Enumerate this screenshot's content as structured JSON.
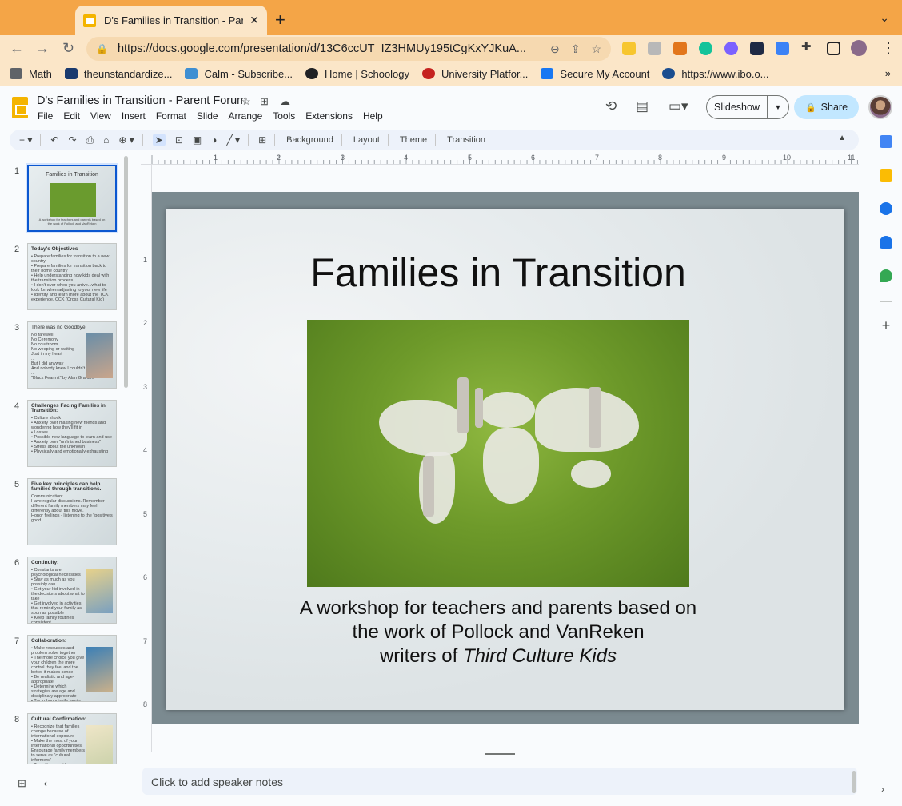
{
  "browser": {
    "tab_title": "D's Families in Transition - Pare",
    "url": "https://docs.google.com/presentation/d/13C6ccUT_IZ3HMUy195tCgKxYJKuA...",
    "bookmarks": [
      "Math",
      "theunstandardize...",
      "Calm - Subscribe...",
      "Home | Schoology",
      "University Platfor...",
      "Secure My Account",
      "https://www.ibo.o..."
    ]
  },
  "doc": {
    "title": "D's Families in Transition - Parent Forum",
    "menus": [
      "File",
      "Edit",
      "View",
      "Insert",
      "Format",
      "Slide",
      "Arrange",
      "Tools",
      "Extensions",
      "Help"
    ],
    "slideshow_label": "Slideshow",
    "share_label": "Share"
  },
  "toolbar": {
    "background": "Background",
    "layout": "Layout",
    "theme": "Theme",
    "transition": "Transition"
  },
  "ruler": {
    "h": [
      "1",
      "2",
      "3",
      "4",
      "5",
      "6",
      "7",
      "8",
      "9",
      "10",
      "11"
    ],
    "v": [
      "1",
      "2",
      "3",
      "4",
      "5",
      "6",
      "7",
      "8"
    ]
  },
  "filmstrip": [
    {
      "num": "1",
      "title": "Families in Transition",
      "lines": "A workshop for teachers and parents based on\nthe work of Pollock and VanReken"
    },
    {
      "num": "2",
      "title": "Today's Objectives",
      "lines": "• Prepare families for transition to a new country\n• Prepare families for transition back to their home country\n• Help understanding how kids deal with the transition process\n• I don't over when you arrive...what to look for when adjusting to your new life\n• Identify and learn more about the TCK experience. CCK (Cross Cultural Kid)"
    },
    {
      "num": "3",
      "title": "There was no Goodbye",
      "lines": "No farewell\nNo Ceremony\nNo courtroom\nNo weeping or waiting\nJust in my heart\n...\nBut I did anyway\nAnd nobody knew I couldn't\n...\n\"Black Fearmit\" by Alan Graham"
    },
    {
      "num": "4",
      "title": "Challenges Facing Families in Transition:",
      "lines": "• Culture shock\n• Anxiety over making new friends and wondering how they'll fit in\n• Losses\n• Possible new language to learn and use\n• Anxiety over \"unfinished business\"\n• Stress about the unknown\n• Physically and emotionally exhausting"
    },
    {
      "num": "5",
      "title": "Five key principles can help families through transitions.",
      "lines": "Communication:\nHave regular discussions. Remember different family members may feel differently about this move.\nHonor feelings - listening to the \"positive's good..."
    },
    {
      "num": "6",
      "title": "Continuity:",
      "lines": "• Constants are psychological necessities\n• Stay as much as you possibly can\n• Get your kid involved in the decisions about what to take\n• Get involved in activities that remind your family as soon as possible\n• Keep family routines consistent\n• Maintain family traditions\n• Create \"welcome rituals\""
    },
    {
      "num": "7",
      "title": "Collaboration:",
      "lines": "• Make resources and problem solve together\n• The more choice you give your children the more control they feel and the better it makes sense\n• Be realistic and age-appropriate\n• Determine which strategies are age and disciplinary appropriate\n• Try to honor/unify family feelings"
    },
    {
      "num": "8",
      "title": "Cultural Confirmation:",
      "lines": "• Recognize that families change because of international exposure\n• Make the most of your international opportunities. Encourage family members to serve as \"cultural informers\"\n• Transition must be possible to see the new host country"
    }
  ],
  "slide": {
    "title": "Families in Transition",
    "subtitle_line1": "A workshop for teachers and parents based on",
    "subtitle_line2": "the work of Pollock and VanReken",
    "subtitle_line3_prefix": "writers of ",
    "subtitle_line3_italic": "Third Culture Kids"
  },
  "notes_placeholder": "Click to add speaker notes",
  "colors": {
    "tabstrip": "#f4a547",
    "accent_blue": "#0b57d0",
    "share_bg": "#c2e7ff"
  }
}
